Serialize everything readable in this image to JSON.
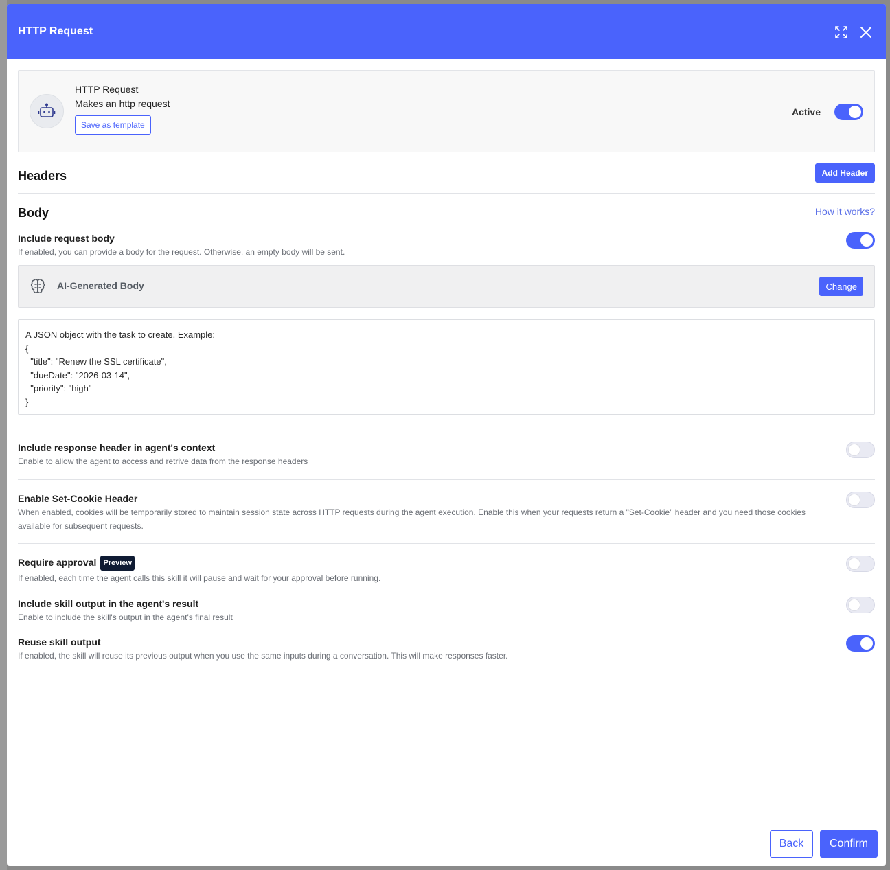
{
  "modal": {
    "title": "HTTP Request"
  },
  "skill": {
    "name": "HTTP Request",
    "description": "Makes an http request",
    "save_template_label": "Save as template",
    "active_label": "Active",
    "active": true
  },
  "headers_section": {
    "title": "Headers",
    "add_button": "Add Header"
  },
  "body_section": {
    "title": "Body",
    "help_link": "How it works?",
    "include_body": {
      "title": "Include request body",
      "description": "If enabled, you can provide a body for the request. Otherwise, an empty body will be sent.",
      "enabled": true
    },
    "ai_body": {
      "label": "AI-Generated Body",
      "change_button": "Change"
    },
    "body_text": "A JSON object with the task to create. Example:\n{\n  \"title\": \"Renew the SSL certificate\",\n  \"dueDate\": \"2026-03-14\",\n  \"priority\": \"high\"\n}"
  },
  "options": {
    "response_header": {
      "title": "Include response header in agent's context",
      "description": "Enable to allow the agent to access and retrive data from the response headers",
      "enabled": false
    },
    "set_cookie": {
      "title": "Enable Set-Cookie Header",
      "description": "When enabled, cookies will be temporarily stored to maintain session state across HTTP requests during the agent execution. Enable this when your requests return a \"Set-Cookie\" header and you need those cookies available for subsequent requests.",
      "enabled": false
    },
    "require_approval": {
      "title": "Require approval",
      "badge": "Preview",
      "description": "If enabled, each time the agent calls this skill it will pause and wait for your approval before running.",
      "enabled": false
    },
    "include_output": {
      "title": "Include skill output in the agent's result",
      "description": "Enable to include the skill's output in the agent's final result",
      "enabled": false
    },
    "reuse_output": {
      "title": "Reuse skill output",
      "description": "If enabled, the skill will reuse its previous output when you use the same inputs during a conversation. This will make responses faster.",
      "enabled": true
    }
  },
  "footer": {
    "back_label": "Back",
    "confirm_label": "Confirm"
  },
  "colors": {
    "accent": "#4a63fc",
    "badge_bg": "#0f1b33"
  },
  "icons": {
    "expand": "expand-icon",
    "close": "close-icon",
    "robot": "robot-icon",
    "brain": "brain-icon"
  }
}
